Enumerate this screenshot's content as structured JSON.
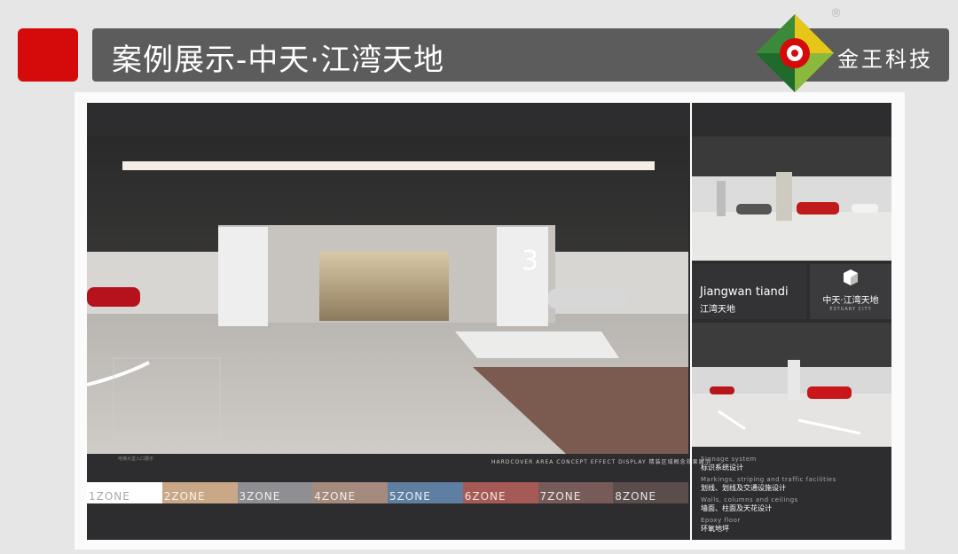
{
  "header": {
    "title": "案例展示-中天·江湾天地",
    "brand": "金王科技",
    "registered_mark": "®",
    "accent_color": "#d50b0b",
    "bar_color": "#5c5c5c",
    "logo_icon": "gear-diamond-logo-icon"
  },
  "board": {
    "main_image_label": "parking-garage-entrance-rendering",
    "caption_left": "电梯大堂入口展示",
    "caption_right": "HARDCOVER AREA CONCEPT EFFECT DISPLAY  精装区域概念效果展示",
    "zones": [
      {
        "label": "1ZONE",
        "color": "#ffffff"
      },
      {
        "label": "2ZONE",
        "color": "#c9a887"
      },
      {
        "label": "3ZONE",
        "color": "#8f8f93"
      },
      {
        "label": "4ZONE",
        "color": "#a58b7e"
      },
      {
        "label": "5ZONE",
        "color": "#5f7fa2"
      },
      {
        "label": "6ZONE",
        "color": "#a65a55"
      },
      {
        "label": "7ZONE",
        "color": "#775b59"
      },
      {
        "label": "8ZONE",
        "color": "#5a4d4c"
      }
    ],
    "project_name_en": "Jiangwan tiandi",
    "project_name_cn": "江湾天地",
    "project_logo_cn": "中天·江湾天地",
    "project_logo_en": "ESTUARY CITY",
    "notes": [
      {
        "en": "Signage system",
        "cn": "标识系统设计"
      },
      {
        "en": "Markings, striping and traffic facilities",
        "cn": "划线、划线及交通设施设计"
      },
      {
        "en": "Walls, columns and ceilings",
        "cn": "墙面、柱面及天花设计"
      },
      {
        "en": "Epoxy floor",
        "cn": "环氧地坪"
      }
    ]
  }
}
